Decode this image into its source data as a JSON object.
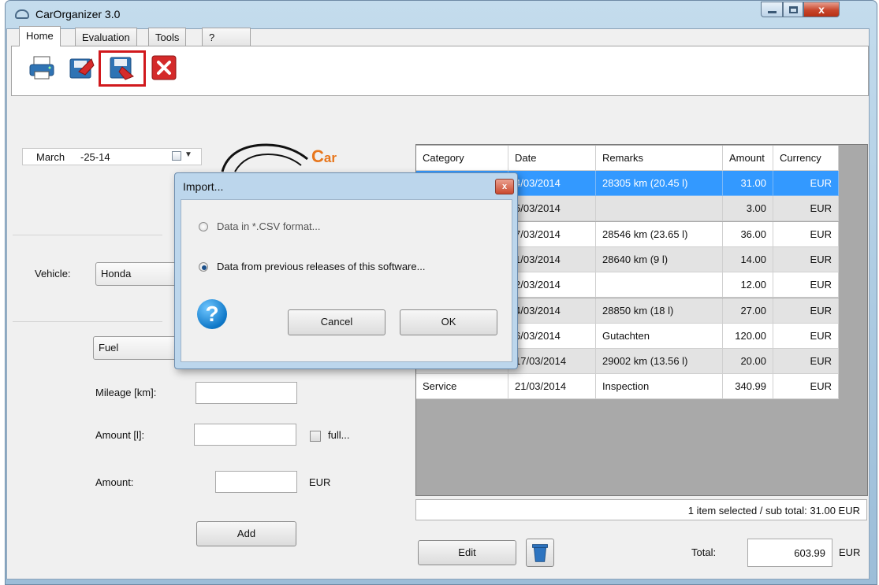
{
  "window": {
    "title": "CarOrganizer 3.0",
    "close_glyph": "x"
  },
  "ribbon": {
    "tabs": [
      {
        "label": "Home",
        "active": true
      },
      {
        "label": "Evaluation",
        "active": false
      },
      {
        "label": "Tools",
        "active": false
      },
      {
        "label": "?",
        "active": false
      }
    ],
    "tools": [
      "print-icon",
      "export-icon",
      "import-icon",
      "exit-icon"
    ],
    "highlight_color": "#d1191d"
  },
  "date": {
    "month": "March",
    "day": "-25-14"
  },
  "logo": {
    "text_c": "C",
    "text_rest": "ar",
    "color": "#e7761c"
  },
  "form": {
    "vehicle_label": "Vehicle:",
    "vehicle_value": "Honda",
    "category_value": "Fuel",
    "mileage_label": "Mileage [km]:",
    "amount_l_label": "Amount [l]:",
    "full_label": "full...",
    "amount_label": "Amount:",
    "currency": "EUR",
    "add_button": "Add"
  },
  "table": {
    "columns": [
      "Category",
      "Date",
      "Remarks",
      "Amount",
      "Currency"
    ],
    "rows": [
      {
        "category": "",
        "date": "4/03/2014",
        "remarks": "28305 km (20.45 l)",
        "amount": "31.00",
        "currency": "EUR",
        "selected": true
      },
      {
        "category": "",
        "date": "5/03/2014",
        "remarks": "",
        "amount": "3.00",
        "currency": "EUR"
      },
      {
        "category": "",
        "date": "7/03/2014",
        "remarks": "28546 km (23.65 l)",
        "amount": "36.00",
        "currency": "EUR"
      },
      {
        "category": "",
        "date": "1/03/2014",
        "remarks": "28640 km (9 l)",
        "amount": "14.00",
        "currency": "EUR"
      },
      {
        "category": "",
        "date": "2/03/2014",
        "remarks": "",
        "amount": "12.00",
        "currency": "EUR"
      },
      {
        "category": "",
        "date": "4/03/2014",
        "remarks": "28850 km (18 l)",
        "amount": "27.00",
        "currency": "EUR"
      },
      {
        "category": "",
        "date": "6/03/2014",
        "remarks": "Gutachten",
        "amount": "120.00",
        "currency": "EUR"
      },
      {
        "category": "Tanken",
        "date": "17/03/2014",
        "remarks": "29002 km (13.56 l)",
        "amount": "20.00",
        "currency": "EUR"
      },
      {
        "category": "Service",
        "date": "21/03/2014",
        "remarks": "Inspection",
        "amount": "340.99",
        "currency": "EUR"
      }
    ],
    "selected_color": "#3399ff"
  },
  "status": {
    "text": "1 item selected  /  sub total: 31.00 EUR"
  },
  "footer": {
    "edit_button": "Edit",
    "total_label": "Total:",
    "total_value": "603.99",
    "total_currency": "EUR"
  },
  "dialog": {
    "title": "Import...",
    "option_csv": "Data in *.CSV format...",
    "option_previous": "Data from previous releases of this software...",
    "selected_option": "previous",
    "cancel": "Cancel",
    "ok": "OK",
    "icon_glyph": "?",
    "close_glyph": "x"
  }
}
